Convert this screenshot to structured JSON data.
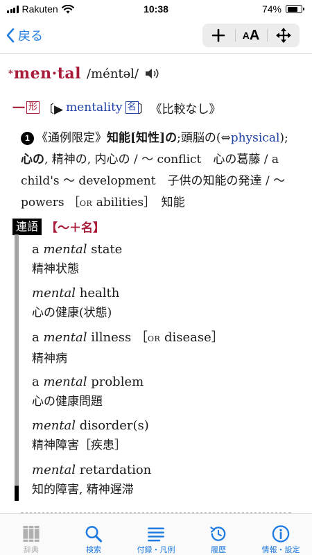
{
  "status": {
    "carrier": "Rakuten",
    "time": "10:38",
    "battery": "74%",
    "battery_level": 0.74
  },
  "nav": {
    "back_label": "戻る",
    "plus_label": "+",
    "font_small": "A",
    "font_big": "A",
    "move_icon": "move-arrows-icon"
  },
  "entry": {
    "headword_mark": "*",
    "headword": "men·tal",
    "pronunciation": "/méntəl/",
    "pos_mark": "一",
    "pos_tag": "形",
    "bracket_open": "〔▶",
    "derived_word": "mentality",
    "derived_pos": "名",
    "bracket_close": "〕",
    "comparison": "《比較なし》",
    "def": {
      "number": "1",
      "note": "《通例限定》",
      "main_1": "知能",
      "bracket_1": "[",
      "main_2": "知性",
      "bracket_2": "]",
      "particle": "の",
      "text_1": ";頭脳の(⇔",
      "antonym": "physical",
      "text_2": ");",
      "bold_2": "心の",
      "text_3": ", 精神の, 内心の / ～ conflict　心の葛藤 / a child's ～ development　子供の知能の発達 / ～ powers ［",
      "or_1": "OR",
      "text_4": " abilities］　知能"
    }
  },
  "rengo": {
    "tag": "連語",
    "pattern": "【～＋名】",
    "items": [
      {
        "pre": "a ",
        "term": "mental",
        "post": " state",
        "ja": "精神状態"
      },
      {
        "pre": "",
        "term": "mental",
        "post": " health",
        "ja": "心の健康(状態)"
      },
      {
        "pre": "a ",
        "term": "mental",
        "post": " illness ［",
        "or": "OR",
        "post2": " disease］",
        "ja": "精神病"
      },
      {
        "pre": "a ",
        "term": "mental",
        "post": " problem",
        "ja": "心の健康問題"
      },
      {
        "pre": "",
        "term": "mental",
        "post": " disorder(s)",
        "ja": "精神障害［疾患］"
      },
      {
        "pre": "",
        "term": "mental",
        "post": " retardation",
        "ja": "知的障害, 精神遅滞"
      }
    ]
  },
  "tabs": [
    {
      "label": "辞典",
      "icon": "dictionary-icon",
      "enabled": false
    },
    {
      "label": "検索",
      "icon": "search-icon",
      "enabled": true
    },
    {
      "label": "付録・凡例",
      "icon": "list-icon",
      "enabled": true
    },
    {
      "label": "履歴",
      "icon": "history-icon",
      "enabled": true
    },
    {
      "label": "情報・設定",
      "icon": "info-icon",
      "enabled": true
    }
  ],
  "colors": {
    "accent_blue": "#1f7be0",
    "headword_red": "#a81c3a",
    "link_blue": "#1d3fa5"
  }
}
